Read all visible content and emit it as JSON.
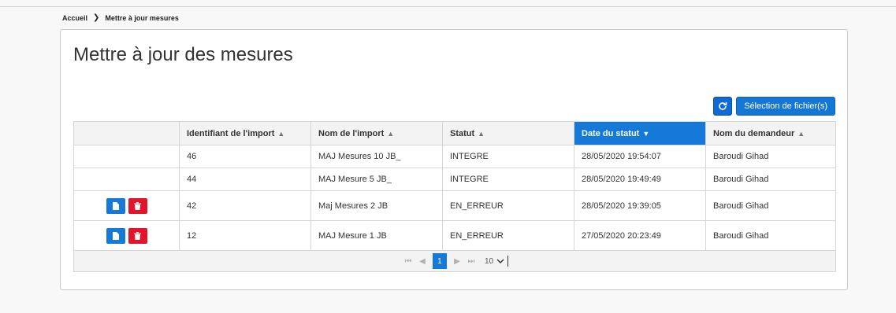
{
  "breadcrumb": {
    "home": "Accueil",
    "separator": "❯",
    "current": "Mettre à jour mesures"
  },
  "page": {
    "title": "Mettre à jour des mesures"
  },
  "toolbar": {
    "refresh_icon": "refresh-icon",
    "select_label": "Sélection de fichier(s)"
  },
  "table": {
    "columns": [
      {
        "label": ""
      },
      {
        "label": "Identifiant de l'import",
        "sort": "both"
      },
      {
        "label": "Nom de l'import",
        "sort": "both"
      },
      {
        "label": "Statut",
        "sort": "both"
      },
      {
        "label": "Date du statut",
        "sort": "desc",
        "active": true
      },
      {
        "label": "Nom du demandeur",
        "sort": "both"
      }
    ],
    "rows": [
      {
        "actions": false,
        "id": "46",
        "name": "MAJ Mesures 10 JB_",
        "status": "INTEGRE",
        "date": "28/05/2020 19:54:07",
        "requester": "Baroudi Gihad"
      },
      {
        "actions": false,
        "id": "44",
        "name": "MAJ Mesure 5 JB_",
        "status": "INTEGRE",
        "date": "28/05/2020 19:49:49",
        "requester": "Baroudi Gihad"
      },
      {
        "actions": true,
        "id": "42",
        "name": "Maj Mesures 2 JB",
        "status": "EN_ERREUR",
        "date": "28/05/2020 19:39:05",
        "requester": "Baroudi Gihad"
      },
      {
        "actions": true,
        "id": "12",
        "name": "MAJ Mesure 1 JB",
        "status": "EN_ERREUR",
        "date": "27/05/2020 20:23:49",
        "requester": "Baroudi Gihad"
      }
    ]
  },
  "pager": {
    "current_page": "1",
    "page_size": "10"
  },
  "colors": {
    "accent": "#1479d8",
    "danger": "#e3142a"
  }
}
